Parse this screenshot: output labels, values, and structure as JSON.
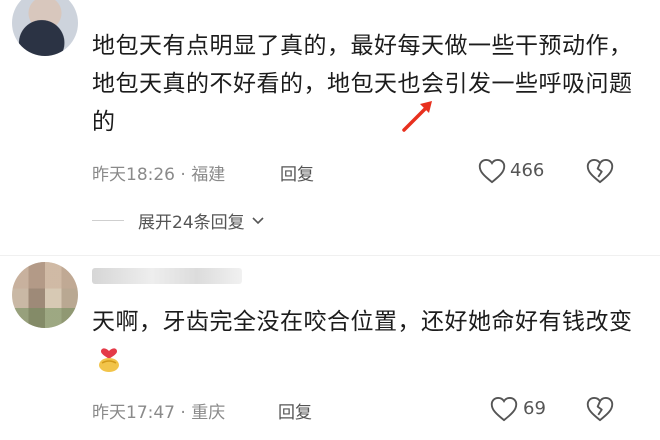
{
  "comments": [
    {
      "text": "地包天有点明显了真的，最好每天做一些干预动作，地包天真的不好看的，地包天也会引发一些呼吸问题的",
      "time": "昨天18:26",
      "location": "福建",
      "reply_label": "回复",
      "like_count": "466",
      "expand_replies": "展开24条回复"
    },
    {
      "text": "天啊，牙齿完全没在咬合位置，还好她命好有钱改变",
      "time": "昨天17:47",
      "location": "重庆",
      "reply_label": "回复",
      "like_count": "69"
    }
  ],
  "colors": {
    "annotation_arrow": "#e8301e",
    "meta": "#8a8a8a"
  },
  "icons": [
    "heart-icon",
    "dislike-heart-icon",
    "chevron-down-icon",
    "red-arrow-annotation",
    "emoji-heart-sticker"
  ]
}
